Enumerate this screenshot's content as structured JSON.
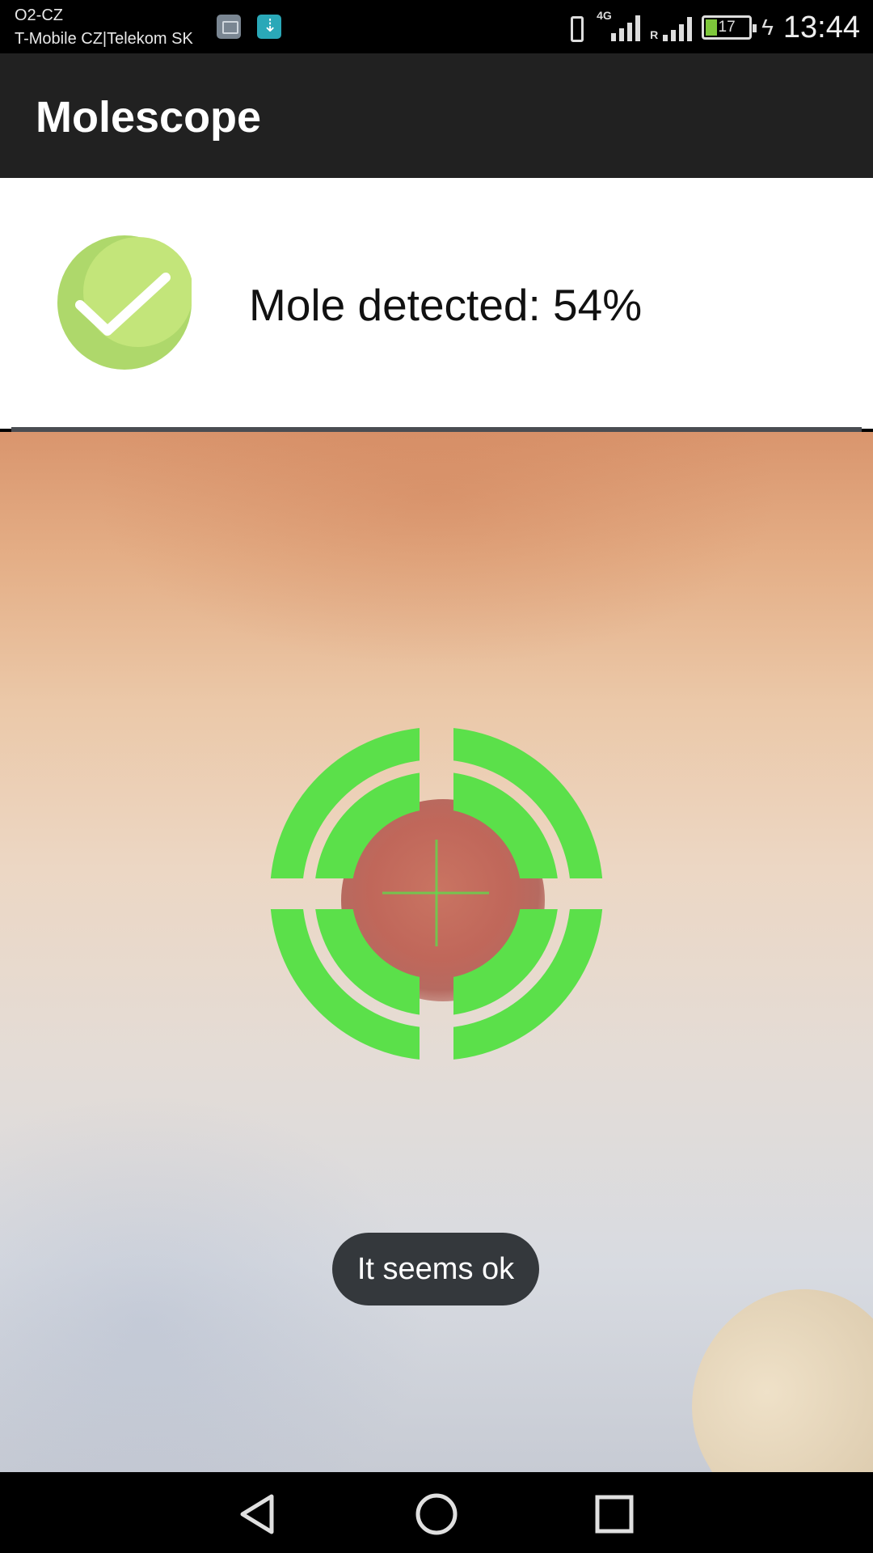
{
  "status_bar": {
    "carrier_primary": "O2-CZ",
    "carrier_secondary": "T-Mobile CZ|Telekom SK",
    "network_type": "4G",
    "roaming_indicator": "R",
    "battery_percent": "17",
    "time": "13:44",
    "icons": [
      "gallery-icon",
      "download-icon",
      "vibrate-icon",
      "signal-4g-icon",
      "signal-roaming-icon",
      "battery-icon",
      "charging-icon"
    ]
  },
  "app_bar": {
    "title": "Molescope"
  },
  "result": {
    "icon": "check-circle-icon",
    "text": "Mole detected: 54%",
    "colors": {
      "badge_light": "#c3e57a",
      "badge_dark": "#aed86b",
      "check": "#ffffff"
    }
  },
  "camera": {
    "reticle_color": "#5be04a"
  },
  "toast": {
    "message": "It seems ok"
  },
  "nav_bar": {
    "buttons": [
      "back-icon",
      "home-icon",
      "recents-icon"
    ]
  }
}
